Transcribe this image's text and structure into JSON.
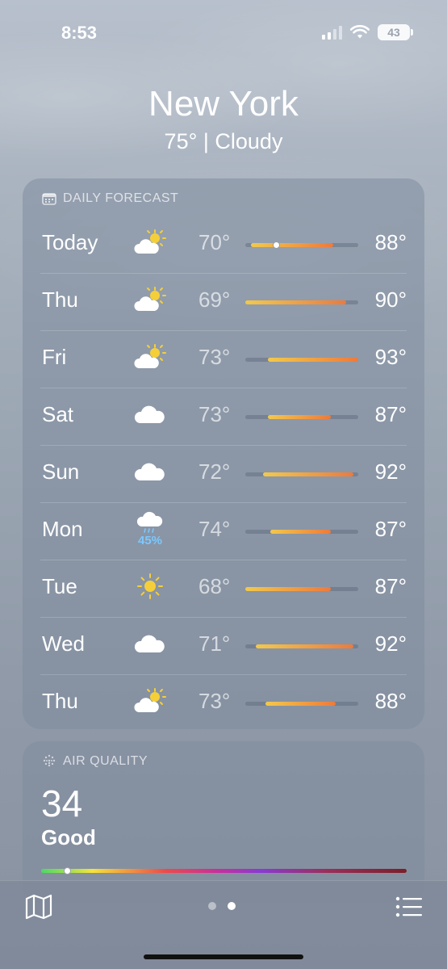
{
  "status": {
    "time": "8:53",
    "battery": "43"
  },
  "header": {
    "city": "New York",
    "current": "75° | Cloudy"
  },
  "forecast": {
    "title": "DAILY FORECAST",
    "days": [
      {
        "day": "Today",
        "icon": "partly-cloudy-icon",
        "low": "70°",
        "high": "88°",
        "range_start": 0.05,
        "range_end": 0.78,
        "current": 0.27,
        "precip": null
      },
      {
        "day": "Thu",
        "icon": "partly-cloudy-icon",
        "low": "69°",
        "high": "90°",
        "range_start": 0.0,
        "range_end": 0.89,
        "current": null,
        "precip": null
      },
      {
        "day": "Fri",
        "icon": "partly-cloudy-icon",
        "low": "73°",
        "high": "93°",
        "range_start": 0.2,
        "range_end": 1.0,
        "current": null,
        "precip": null
      },
      {
        "day": "Sat",
        "icon": "cloud-icon",
        "low": "73°",
        "high": "87°",
        "range_start": 0.2,
        "range_end": 0.76,
        "current": null,
        "precip": null
      },
      {
        "day": "Sun",
        "icon": "cloud-icon",
        "low": "72°",
        "high": "92°",
        "range_start": 0.16,
        "range_end": 0.96,
        "current": null,
        "precip": null
      },
      {
        "day": "Mon",
        "icon": "rain-cloud-icon",
        "low": "74°",
        "high": "87°",
        "range_start": 0.22,
        "range_end": 0.76,
        "current": null,
        "precip": "45%"
      },
      {
        "day": "Tue",
        "icon": "sun-icon",
        "low": "68°",
        "high": "87°",
        "range_start": 0.0,
        "range_end": 0.76,
        "current": null,
        "precip": null
      },
      {
        "day": "Wed",
        "icon": "cloud-icon",
        "low": "71°",
        "high": "92°",
        "range_start": 0.09,
        "range_end": 0.96,
        "current": null,
        "precip": null
      },
      {
        "day": "Thu",
        "icon": "partly-cloudy-icon",
        "low": "73°",
        "high": "88°",
        "range_start": 0.18,
        "range_end": 0.8,
        "current": null,
        "precip": null
      }
    ]
  },
  "air_quality": {
    "title": "AIR QUALITY",
    "value": "34",
    "label": "Good",
    "position": 0.07
  },
  "toolbar": {
    "pages": 2,
    "active_page": 1
  },
  "colors": {
    "bar_start": "#f2c94c",
    "bar_end": "#ee7a3b",
    "precip": "#7cc8ff"
  }
}
